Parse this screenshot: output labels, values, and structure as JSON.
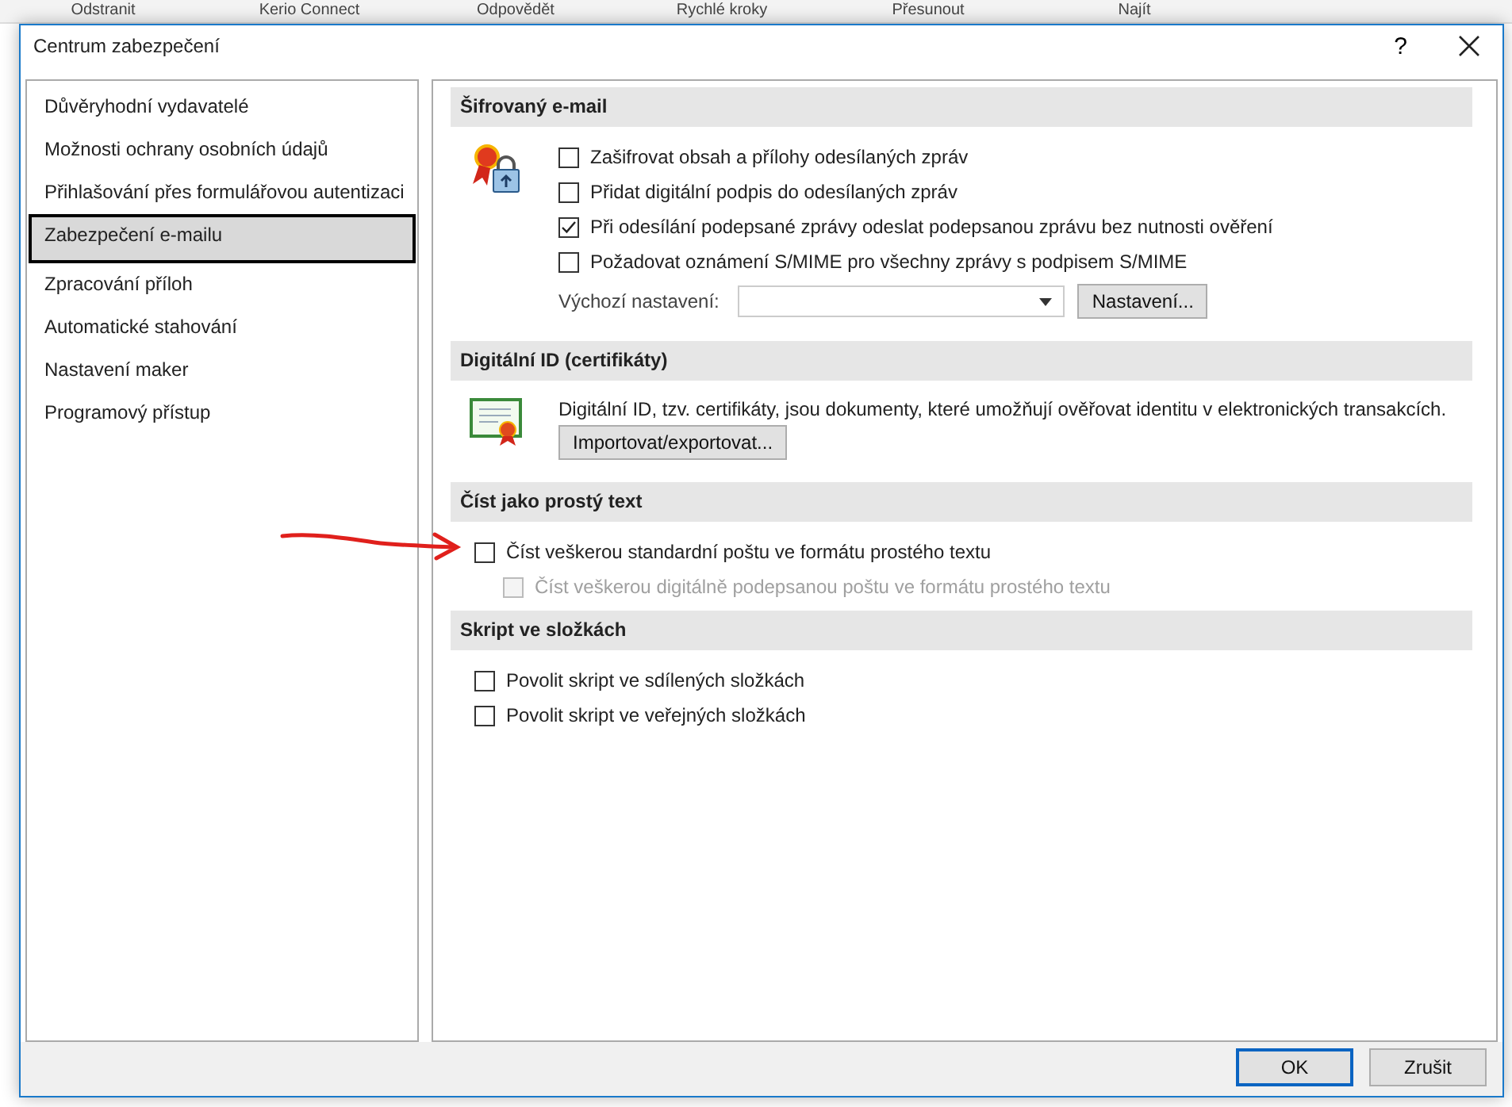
{
  "background_ribbon": {
    "group_labels": [
      "Odstranit",
      "Kerio Connect",
      "Odpovědět",
      "Rychlé kroky",
      "Přesunout",
      "Najít"
    ]
  },
  "window": {
    "title": "Centrum zabezpečení",
    "help_button": "?"
  },
  "sidebar": {
    "items": [
      {
        "label": "Důvěryhodní vydavatelé",
        "selected": false
      },
      {
        "label": "Možnosti ochrany osobních údajů",
        "selected": false
      },
      {
        "label": "Přihlašování přes formulářovou autentizaci",
        "selected": false
      },
      {
        "label": "Zabezpečení e-mailu",
        "selected": true
      },
      {
        "label": "Zpracování příloh",
        "selected": false
      },
      {
        "label": "Automatické stahování",
        "selected": false
      },
      {
        "label": "Nastavení maker",
        "selected": false
      },
      {
        "label": "Programový přístup",
        "selected": false
      }
    ]
  },
  "sections": [
    {
      "title": "Šifrovaný e-mail",
      "kind": "encryption",
      "options": [
        {
          "label": "Zašifrovat obsah a přílohy odesílaných zpráv",
          "checked": false,
          "disabled": false
        },
        {
          "label": "Přidat digitální podpis do odesílaných zpráv",
          "checked": false,
          "disabled": false
        },
        {
          "label": "Při odesílání podepsané zprávy odeslat podepsanou zprávu bez nutnosti ověření",
          "checked": true,
          "disabled": false
        },
        {
          "label": "Požadovat oznámení S/MIME pro všechny zprávy s podpisem S/MIME",
          "checked": false,
          "disabled": false
        }
      ],
      "default_setting": {
        "label": "Výchozí nastavení:",
        "button": "Nastavení..."
      }
    },
    {
      "title": "Digitální ID (certifikáty)",
      "kind": "digital_id",
      "description": "Digitální ID, tzv. certifikáty, jsou dokumenty, které umožňují ověřovat identitu v elektronických transakcích.",
      "button": "Importovat/exportovat..."
    },
    {
      "title": "Číst jako prostý text",
      "kind": "plain_text",
      "options": [
        {
          "label": "Číst veškerou standardní poštu ve formátu prostého textu",
          "checked": false,
          "disabled": false,
          "children": [
            {
              "label": "Číst veškerou digitálně podepsanou poštu ve formátu prostého textu",
              "checked": false,
              "disabled": true
            }
          ]
        }
      ]
    },
    {
      "title": "Skript ve složkách",
      "kind": "scripts",
      "options": [
        {
          "label": "Povolit skript ve sdílených složkách",
          "checked": false,
          "disabled": false
        },
        {
          "label": "Povolit skript ve veřejných složkách",
          "checked": false,
          "disabled": false
        }
      ]
    }
  ],
  "buttons": [
    {
      "label": "OK",
      "default": true
    },
    {
      "label": "Zrušit",
      "default": false
    }
  ]
}
